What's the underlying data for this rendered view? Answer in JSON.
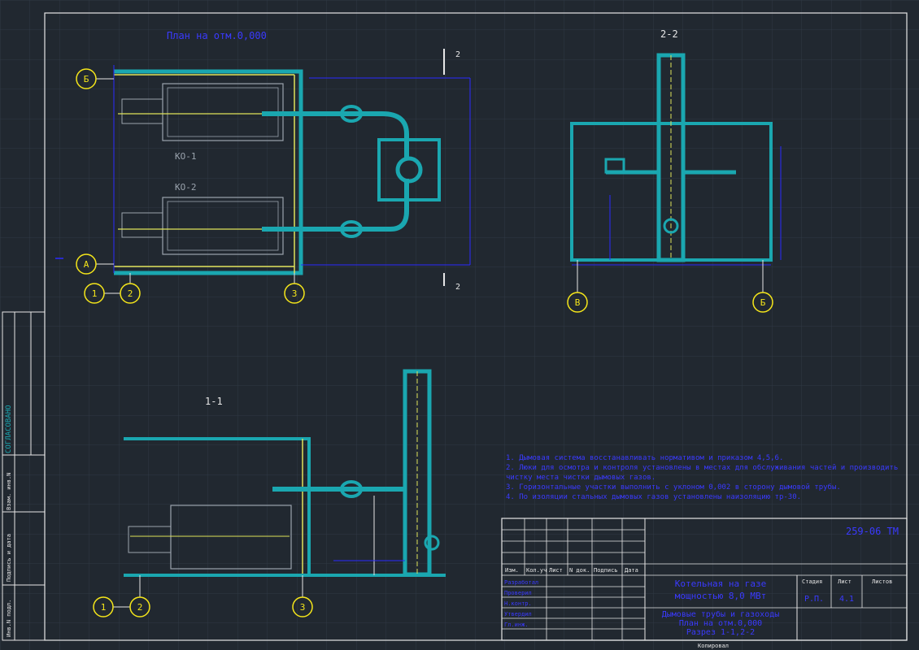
{
  "colors": {
    "background": "#212830",
    "grid": "#2f3944",
    "frame": "#e6e6e6",
    "pipe": "#1aa7b0",
    "dimension": "#2a2aff",
    "equipment": "#9aa3ad",
    "axis_circle": "#f5e61a",
    "title_text": "#3a3aff"
  },
  "views": {
    "plan_title": "План на отм.0,000",
    "section_22_title": "2-2",
    "section_11_title": "1-1"
  },
  "labels": {
    "boiler_1": "КО-1",
    "boiler_2": "КО-2",
    "cut_2": "2"
  },
  "axes": {
    "plan": [
      "Б",
      "А",
      "1",
      "2",
      "3"
    ],
    "section_22": [
      "В",
      "Б"
    ],
    "section_11": [
      "1",
      "2",
      "3"
    ]
  },
  "notes": [
    "1. Дымовая система восстанавливать нормативом и приказом 4,5,6.",
    "2. Люки для осмотра и контроля установлены в местах для обслуживания частей и производить",
    "чистку места чистки дымовых газов.",
    "3. Горизонтальные участки выполнить с уклоном 0,002 в сторону дымовой трубы.",
    "4. По изоляции стальных дымовых газов установлены наизоляцию тр-30."
  ],
  "stamp": {
    "doc_code": "259-06 ТМ",
    "col_headers": [
      "Изм.",
      "Кол.уч",
      "Лист",
      "N док.",
      "Подпись",
      "Дата"
    ],
    "roles": [
      "Разработал",
      "Проверил",
      "Н.контр.",
      "Утвердил",
      "Гл.инж."
    ],
    "object_title_1": "Котельная на газе",
    "object_title_2": "мощностью 8,0 МВт",
    "sheet_title_1": "Дымовые трубы и газоходы",
    "sheet_title_2": "План на отм.0,000",
    "sheet_title_3": "Разрез 1-1,2-2",
    "stage_header": "Стадия",
    "sheet_header": "Лист",
    "sheets_header": "Листов",
    "stage_value": "Р.П.",
    "sheet_value": "4.1",
    "sheets_value": "",
    "copied": "Копировал"
  },
  "side_stamp": {
    "agreed": "СОГЛАСОВАНО",
    "fields": [
      "Взам. инв.N",
      "Подпись и дата",
      "Инв.N подл."
    ]
  }
}
